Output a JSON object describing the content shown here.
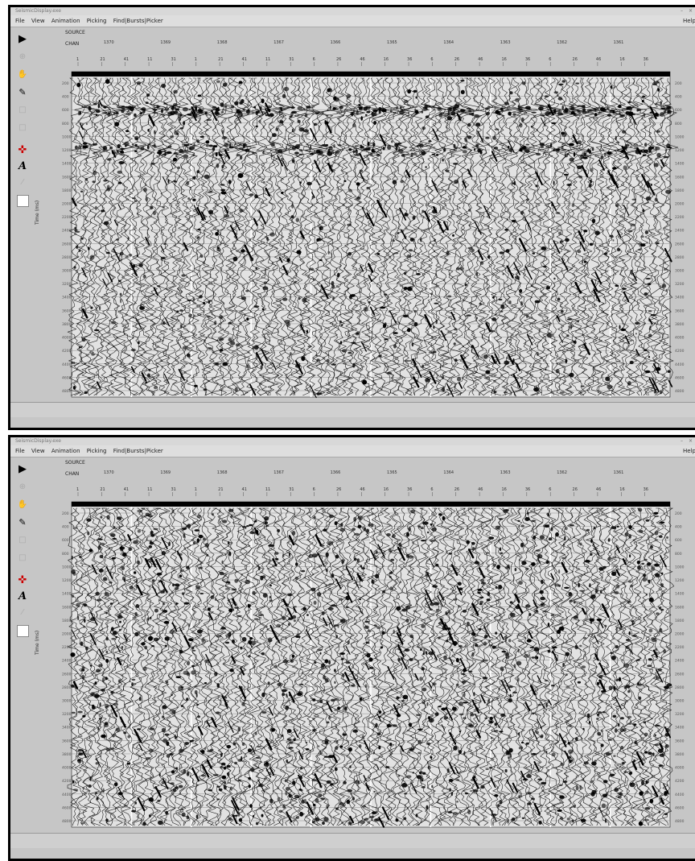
{
  "windows": [
    {
      "id": "win1",
      "title": "SeismicDisplay.exe",
      "menu": [
        "File",
        "View",
        "Animation",
        "Picking",
        "Find|Bursts|Picker"
      ],
      "menu_right": "Help",
      "header": {
        "source_label": "SOURCE",
        "cdp_label": "CHAN",
        "top_values": [
          "1370",
          "1369",
          "1368",
          "1367",
          "1366",
          "1365",
          "1364",
          "1363",
          "1362",
          "1361"
        ],
        "bottom_values": [
          "1",
          "21",
          "41",
          "11",
          "31",
          "1",
          "21",
          "41",
          "11",
          "31",
          "6",
          "26",
          "46",
          "16",
          "36",
          "6",
          "26",
          "46",
          "16",
          "36",
          "6",
          "26",
          "46",
          "16",
          "36"
        ]
      },
      "vertical_label": "Time (ms)",
      "time_ticks": [
        "200",
        "400",
        "600",
        "800",
        "1000",
        "1200",
        "1400",
        "1600",
        "1800",
        "2000",
        "2200",
        "2400",
        "2600",
        "2800",
        "3000",
        "3200",
        "3400",
        "3600",
        "3800",
        "4000",
        "4200",
        "4400",
        "4600",
        "4800"
      ],
      "mode": "raw"
    },
    {
      "id": "win2",
      "title": "SeismicDisplay.exe",
      "menu": [
        "File",
        "View",
        "Animation",
        "Picking",
        "Find|Bursts|Picker"
      ],
      "menu_right": "Help",
      "header": {
        "source_label": "SOURCE",
        "cdp_label": "CHAN",
        "top_values": [
          "1370",
          "1369",
          "1368",
          "1367",
          "1366",
          "1365",
          "1364",
          "1363",
          "1362",
          "1361"
        ],
        "bottom_values": [
          "1",
          "21",
          "41",
          "11",
          "31",
          "1",
          "21",
          "41",
          "11",
          "31",
          "6",
          "26",
          "46",
          "16",
          "36",
          "6",
          "26",
          "46",
          "16",
          "36",
          "6",
          "26",
          "46",
          "16",
          "36"
        ]
      },
      "vertical_label": "Time (ms)",
      "time_ticks": [
        "200",
        "400",
        "600",
        "800",
        "1000",
        "1200",
        "1400",
        "1600",
        "1800",
        "2000",
        "2200",
        "2400",
        "2600",
        "2800",
        "3000",
        "3200",
        "3400",
        "3600",
        "3800",
        "4000",
        "4200",
        "4400",
        "4600",
        "4800"
      ],
      "mode": "balanced"
    }
  ],
  "toolbar_icons": [
    "play-icon",
    "zoom-icon",
    "hand-pan-icon",
    "eraser-icon",
    "blank-icon",
    "crosshair-icon",
    "text-icon",
    "pencil-icon",
    "color-box-icon"
  ],
  "colors": {
    "background": "#c6c6c6",
    "ink": "#000000",
    "window_border": "#000000"
  }
}
